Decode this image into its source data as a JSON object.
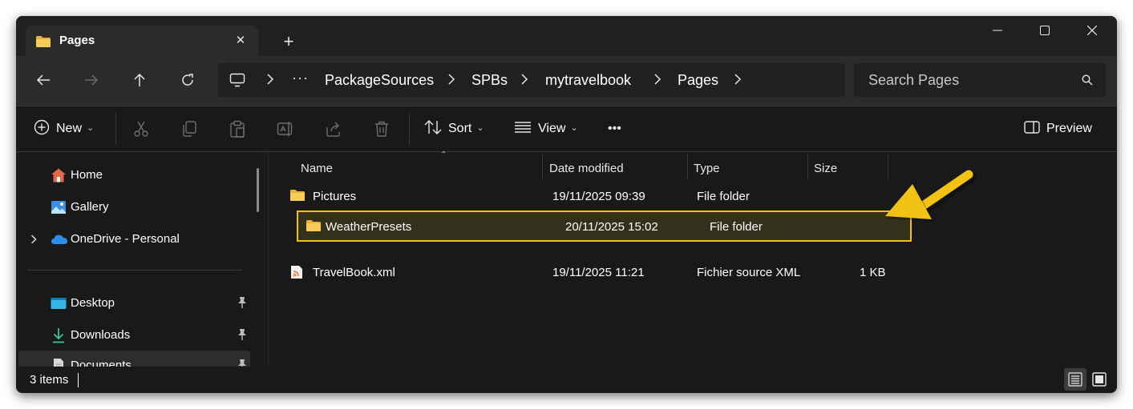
{
  "window": {
    "tab_title": "Pages",
    "tab_close": "✕",
    "new_tab": "+",
    "accent_color": "#f2c314"
  },
  "addressbar": {
    "more": "···",
    "breadcrumbs": [
      "PackageSources",
      "SPBs",
      "mytravelbook",
      "Pages"
    ],
    "search_placeholder": "Search Pages"
  },
  "toolbar": {
    "new_label": "New",
    "sort_label": "Sort",
    "view_label": "View",
    "more": "•••",
    "preview_label": "Preview"
  },
  "nav": {
    "items": [
      {
        "label": "Home",
        "icon": "home-icon"
      },
      {
        "label": "Gallery",
        "icon": "gallery-icon"
      },
      {
        "label": "OneDrive - Personal",
        "icon": "cloud-icon"
      },
      {
        "label": "Desktop",
        "icon": "desktop-icon"
      },
      {
        "label": "Downloads",
        "icon": "download-icon"
      },
      {
        "label": "Documents",
        "icon": "document-icon"
      }
    ]
  },
  "files": {
    "columns": [
      "Name",
      "Date modified",
      "Type",
      "Size"
    ],
    "rows": [
      {
        "name": "Pictures",
        "date": "19/11/2025 09:39",
        "type": "File folder",
        "size": "",
        "icon": "folder-icon"
      },
      {
        "name": "WeatherPresets",
        "date": "20/11/2025 15:02",
        "type": "File folder",
        "size": "",
        "icon": "folder-icon",
        "highlighted": true
      },
      {
        "name": "TravelBook.xml",
        "date": "19/11/2025 11:21",
        "type": "Fichier source XML",
        "size": "1 KB",
        "icon": "xml-file-icon"
      }
    ]
  },
  "status": {
    "count": "3 items"
  }
}
